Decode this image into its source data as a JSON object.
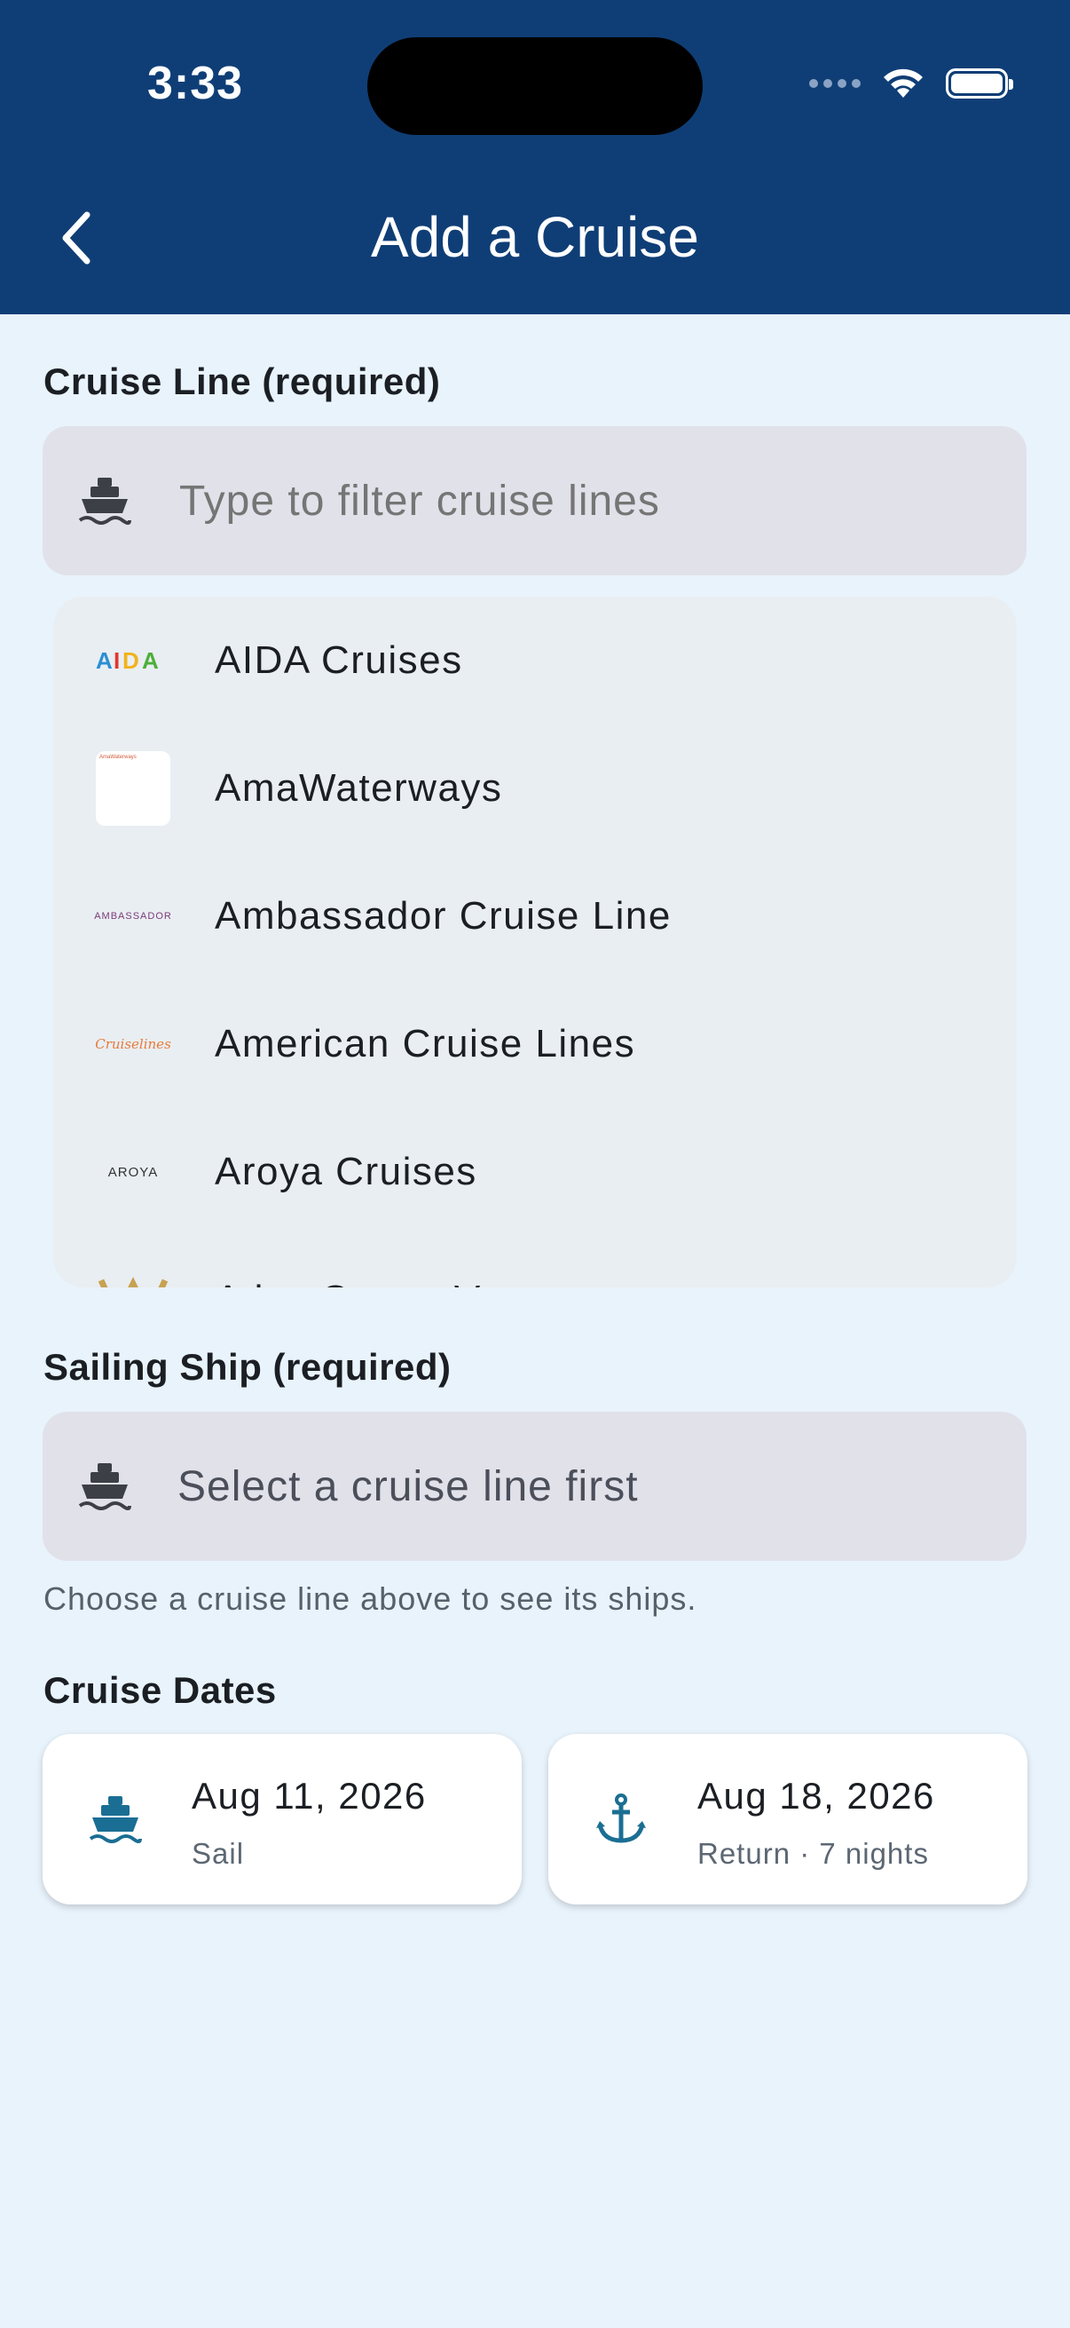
{
  "status_bar": {
    "time": "3:33"
  },
  "header": {
    "title": "Add a Cruise"
  },
  "cruise_line": {
    "label": "Cruise Line (required)",
    "placeholder": "Type to filter cruise lines",
    "options": [
      {
        "name": "AIDA Cruises",
        "logo_text": "AIDA"
      },
      {
        "name": "AmaWaterways",
        "logo_text": "AmaWaterways"
      },
      {
        "name": "Ambassador Cruise Line",
        "logo_text": "AMBASSADOR"
      },
      {
        "name": "American Cruise Lines",
        "logo_text": "Cruiselines"
      },
      {
        "name": "Aroya Cruises",
        "logo_text": "AROYA"
      },
      {
        "name": "Atlas Ocean Voyages",
        "logo_text": ""
      }
    ]
  },
  "sailing_ship": {
    "label": "Sailing Ship (required)",
    "placeholder": "Select a cruise line first",
    "helper": "Choose a cruise line above to see its ships."
  },
  "cruise_dates": {
    "label": "Cruise Dates",
    "sail": {
      "date": "Aug 11, 2026",
      "caption": "Sail"
    },
    "return": {
      "date": "Aug 18, 2026",
      "caption": "Return · 7 nights"
    }
  },
  "colors": {
    "header_bg": "#0f3e76",
    "page_bg": "#e9f3fb",
    "accent": "#1b6e93",
    "field_bg": "#e1e1ea"
  }
}
